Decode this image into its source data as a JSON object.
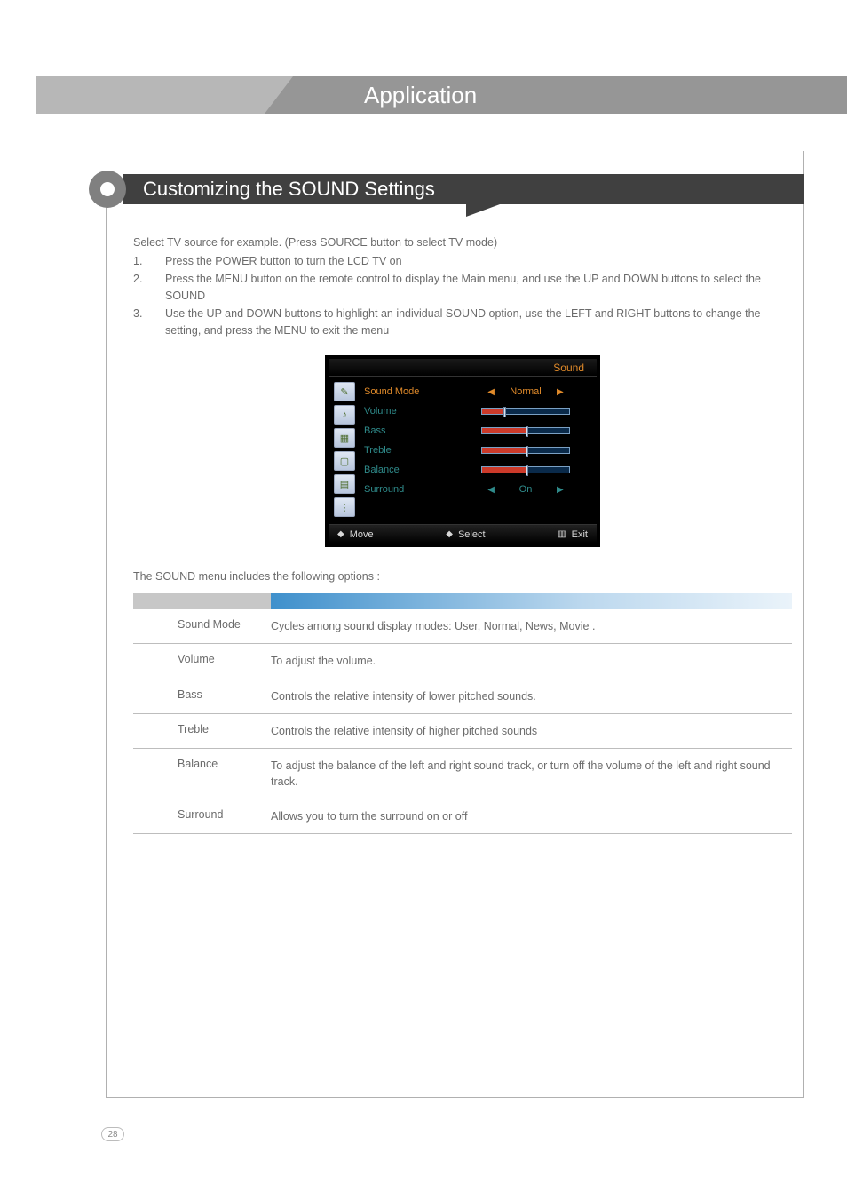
{
  "header": {
    "title": "Application"
  },
  "section": {
    "title": "Customizing the SOUND Settings"
  },
  "intro": "Select TV source for example. (Press SOURCE button to select TV mode)",
  "steps": [
    {
      "num": "1.",
      "text": "Press the POWER button to turn the LCD TV on"
    },
    {
      "num": "2.",
      "text": "Press the MENU button on the remote control to display the Main menu, and use the UP and DOWN buttons to select the SOUND"
    },
    {
      "num": "3.",
      "text": "Use the UP and DOWN buttons to highlight an individual SOUND option, use the LEFT and RIGHT buttons to change the setting, and press the MENU to exit the menu"
    }
  ],
  "osd": {
    "title": "Sound",
    "rows": {
      "sound_mode": {
        "label": "Sound Mode",
        "value": "Normal"
      },
      "volume": {
        "label": "Volume",
        "fill": 24
      },
      "bass": {
        "label": "Bass",
        "fill": 50
      },
      "treble": {
        "label": "Treble",
        "fill": 50
      },
      "balance": {
        "label": "Balance",
        "fill": 50
      },
      "surround": {
        "label": "Surround",
        "value": "On"
      }
    },
    "footer": {
      "move": "Move",
      "select": "Select",
      "exit": "Exit"
    }
  },
  "options_intro": "The SOUND menu includes the following options :",
  "options": [
    {
      "name": "Sound Mode",
      "desc": "Cycles among sound display modes: User, Normal, News, Movie ."
    },
    {
      "name": "Volume",
      "desc": "To adjust the volume."
    },
    {
      "name": "Bass",
      "desc": "Controls the relative intensity of lower pitched sounds."
    },
    {
      "name": "Treble",
      "desc": "Controls the relative intensity of higher pitched sounds"
    },
    {
      "name": "Balance",
      "desc": "To adjust the balance of the left and right sound track, or turn off the volume of the left and right sound track."
    },
    {
      "name": "Surround",
      "desc": "Allows you to turn the surround on or off"
    }
  ],
  "page_number": "28"
}
